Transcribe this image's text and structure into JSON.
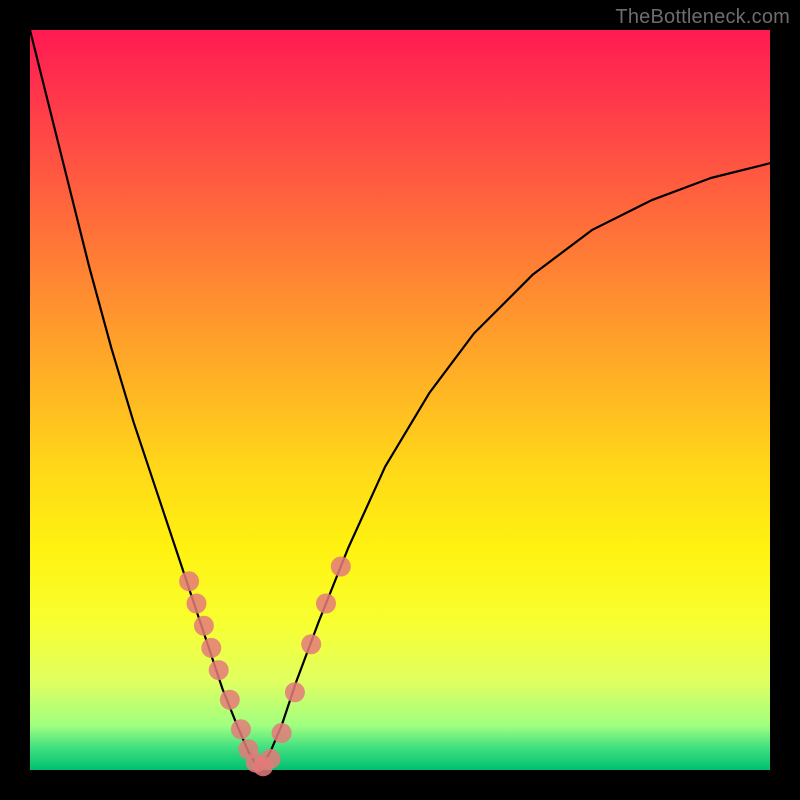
{
  "watermark": "TheBottleneck.com",
  "chart_data": {
    "type": "line",
    "title": "",
    "xlabel": "",
    "ylabel": "",
    "xlim": [
      0,
      1
    ],
    "ylim": [
      0,
      1
    ],
    "series": [
      {
        "name": "bottleneck-curve",
        "x": [
          0.0,
          0.02,
          0.05,
          0.08,
          0.11,
          0.14,
          0.17,
          0.2,
          0.22,
          0.24,
          0.26,
          0.28,
          0.295,
          0.31,
          0.325,
          0.34,
          0.36,
          0.39,
          0.43,
          0.48,
          0.54,
          0.6,
          0.68,
          0.76,
          0.84,
          0.92,
          1.0
        ],
        "y": [
          1.0,
          0.92,
          0.8,
          0.68,
          0.57,
          0.47,
          0.38,
          0.29,
          0.23,
          0.17,
          0.11,
          0.06,
          0.025,
          0.0,
          0.025,
          0.06,
          0.12,
          0.2,
          0.3,
          0.41,
          0.51,
          0.59,
          0.67,
          0.73,
          0.77,
          0.8,
          0.82
        ]
      }
    ],
    "markers": {
      "name": "highlighted-points",
      "color": "#e47a7a",
      "radius": 10,
      "points": [
        {
          "x": 0.215,
          "y": 0.255
        },
        {
          "x": 0.225,
          "y": 0.225
        },
        {
          "x": 0.235,
          "y": 0.195
        },
        {
          "x": 0.245,
          "y": 0.165
        },
        {
          "x": 0.255,
          "y": 0.135
        },
        {
          "x": 0.27,
          "y": 0.095
        },
        {
          "x": 0.285,
          "y": 0.055
        },
        {
          "x": 0.295,
          "y": 0.028
        },
        {
          "x": 0.305,
          "y": 0.01
        },
        {
          "x": 0.315,
          "y": 0.005
        },
        {
          "x": 0.325,
          "y": 0.015
        },
        {
          "x": 0.34,
          "y": 0.05
        },
        {
          "x": 0.358,
          "y": 0.105
        },
        {
          "x": 0.38,
          "y": 0.17
        },
        {
          "x": 0.4,
          "y": 0.225
        },
        {
          "x": 0.42,
          "y": 0.275
        }
      ]
    },
    "gradient_stops": [
      {
        "offset": 0.0,
        "color": "#ff1a52"
      },
      {
        "offset": 0.5,
        "color": "#ffda18"
      },
      {
        "offset": 0.95,
        "color": "#a0ff80"
      },
      {
        "offset": 1.0,
        "color": "#00c070"
      }
    ]
  }
}
